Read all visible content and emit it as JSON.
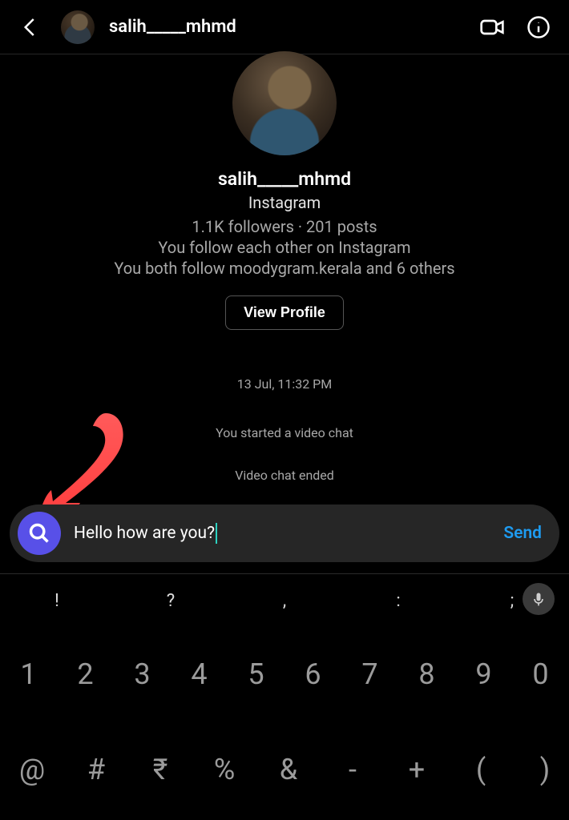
{
  "header": {
    "username": "salih_____mhmd"
  },
  "profile": {
    "username": "salih_____mhmd",
    "platform": "Instagram",
    "stats": "1.1K followers · 201 posts",
    "follow_note": "You follow each other on Instagram",
    "mutuals_note": "You both follow moodygram.kerala and 6 others",
    "view_profile_label": "View Profile"
  },
  "thread": {
    "timestamp": "13 Jul, 11:32 PM",
    "system_messages": [
      "You started a video chat",
      "Video chat ended"
    ]
  },
  "composer": {
    "text": "Hello how are you?",
    "send_label": "Send"
  },
  "keyboard": {
    "punct_row": [
      "!",
      "?",
      ",",
      ":",
      ";"
    ],
    "digit_row": [
      "1",
      "2",
      "3",
      "4",
      "5",
      "6",
      "7",
      "8",
      "9",
      "0"
    ],
    "symbol_row": [
      "@",
      "#",
      "₹",
      "%",
      "&",
      "-",
      "+",
      "(",
      ")"
    ]
  }
}
